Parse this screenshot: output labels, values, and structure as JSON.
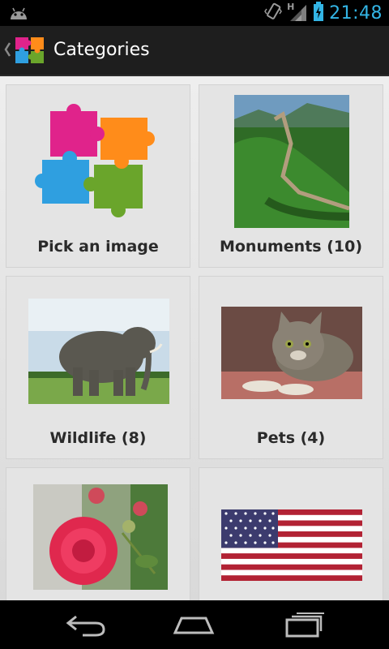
{
  "status_bar": {
    "time": "21:48",
    "network": "H",
    "icons": [
      "android-debug-icon",
      "vibrate-icon",
      "signal-icon",
      "battery-charging-icon"
    ]
  },
  "action_bar": {
    "title": "Categories",
    "icons": [
      "up-caret-icon",
      "puzzle-app-icon"
    ]
  },
  "categories": [
    {
      "label": "Pick an image",
      "image": "puzzle-pieces"
    },
    {
      "label": "Monuments (10)",
      "image": "great-wall"
    },
    {
      "label": "Wildlife (8)",
      "image": "elephant"
    },
    {
      "label": "Pets (4)",
      "image": "kitten"
    },
    {
      "label": "",
      "image": "red-flower"
    },
    {
      "label": "",
      "image": "usa-flag"
    }
  ],
  "nav_bar": {
    "icons": [
      "back-icon",
      "home-icon",
      "recent-apps-icon"
    ]
  },
  "colors": {
    "accent": "#33b5e5",
    "action_bar": "#1e1e1e",
    "tile": "#e4e4e4"
  }
}
